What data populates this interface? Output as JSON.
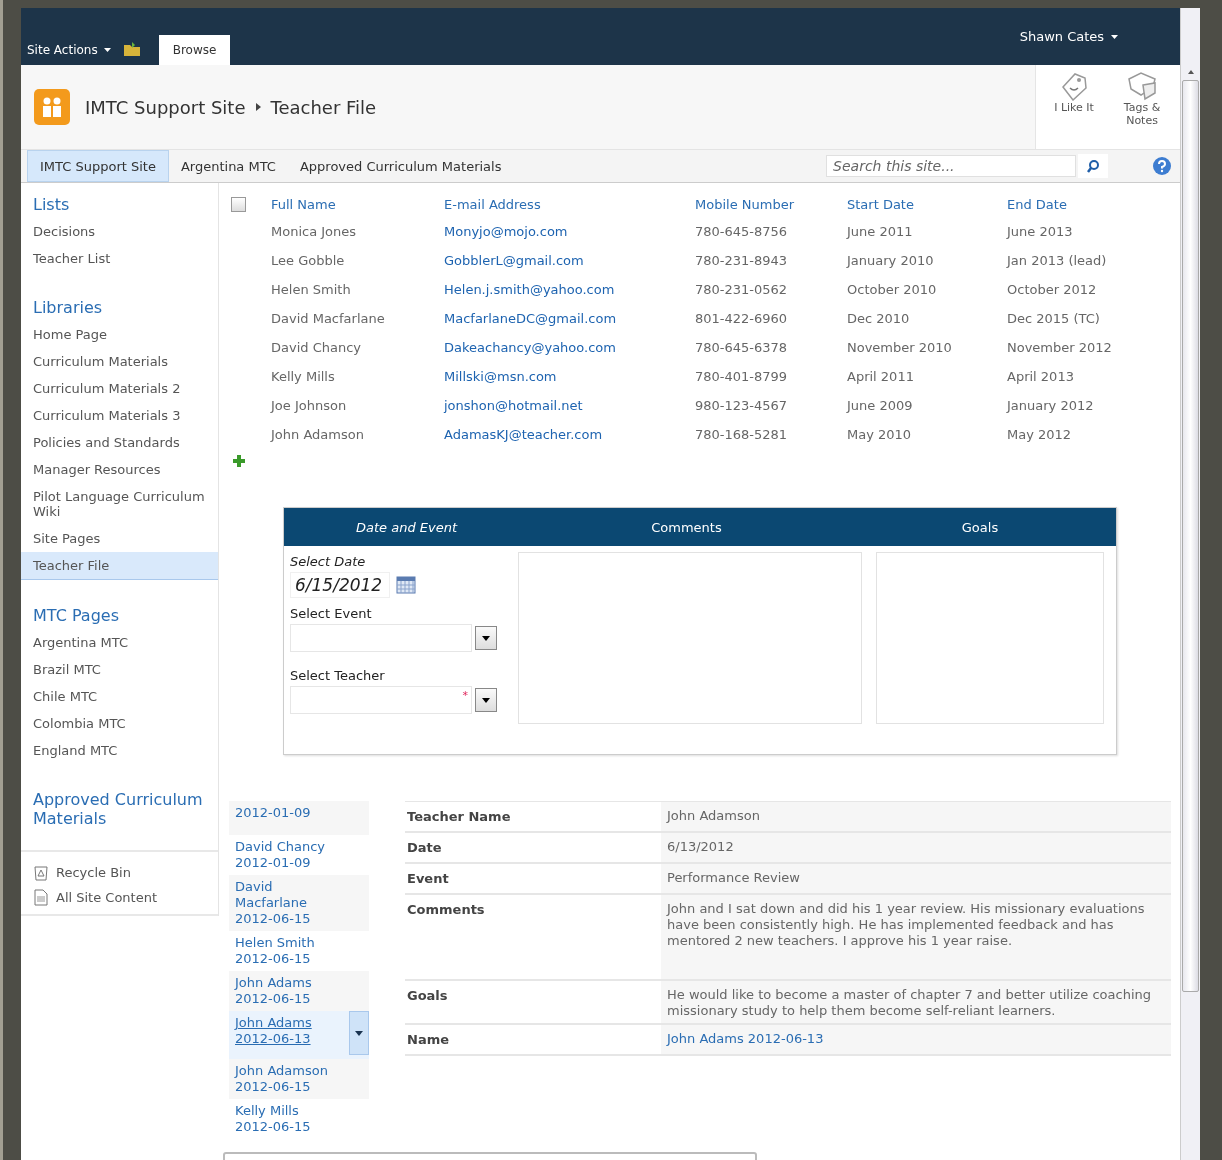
{
  "top_bar": {
    "site_actions": "Site Actions",
    "tabs": [
      {
        "label": "Browse",
        "selected": true
      }
    ],
    "user": "Shawn Cates"
  },
  "header": {
    "breadcrumb": [
      "IMTC Support Site",
      "Teacher File"
    ],
    "actions": [
      {
        "label": "I Like It",
        "kind": "like"
      },
      {
        "label": "Tags & Notes",
        "kind": "tags"
      }
    ]
  },
  "nav_tabs": [
    {
      "label": "IMTC Support Site",
      "selected": true
    },
    {
      "label": "Argentina MTC",
      "selected": false
    },
    {
      "label": "Approved Curriculum Materials",
      "selected": false
    }
  ],
  "search": {
    "placeholder": "Search this site..."
  },
  "quick_launch": {
    "sections": [
      {
        "heading": "Lists",
        "items": [
          {
            "label": "Decisions",
            "selected": false
          },
          {
            "label": "Teacher List",
            "selected": false
          }
        ]
      },
      {
        "heading": "Libraries",
        "items": [
          {
            "label": "Home Page",
            "selected": false
          },
          {
            "label": "Curriculum Materials",
            "selected": false
          },
          {
            "label": "Curriculum Materials 2",
            "selected": false
          },
          {
            "label": "Curriculum Materials 3",
            "selected": false
          },
          {
            "label": "Policies and Standards",
            "selected": false
          },
          {
            "label": "Manager Resources",
            "selected": false
          },
          {
            "label": "Pilot Language Curriculum Wiki",
            "selected": false
          },
          {
            "label": "Site Pages",
            "selected": false
          },
          {
            "label": "Teacher File",
            "selected": true
          }
        ]
      },
      {
        "heading": "MTC Pages",
        "items": [
          {
            "label": "Argentina MTC",
            "selected": false
          },
          {
            "label": "Brazil MTC",
            "selected": false
          },
          {
            "label": "Chile MTC",
            "selected": false
          },
          {
            "label": "Colombia MTC",
            "selected": false
          },
          {
            "label": "England MTC",
            "selected": false
          }
        ]
      },
      {
        "heading": "Approved Curriculum Materials"
      }
    ],
    "footer": [
      {
        "label": "Recycle Bin",
        "kind": "recycle"
      },
      {
        "label": "All Site Content",
        "kind": "content"
      }
    ]
  },
  "teacher_table": {
    "select_all": {
      "checked": false
    },
    "columns": [
      "Full Name",
      "E-mail Address",
      "Mobile Number",
      "Start Date",
      "End Date"
    ],
    "rows": [
      [
        "Monica Jones",
        "Monyjo@mojo.com",
        "780-645-8756",
        "June 2011",
        "June 2013"
      ],
      [
        "Lee Gobble",
        "GobblerL@gmail.com",
        "780-231-8943",
        "January 2010",
        "Jan 2013 (lead)"
      ],
      [
        "Helen Smith",
        "Helen.j.smith@yahoo.com",
        "780-231-0562",
        "October 2010",
        "October 2012"
      ],
      [
        "David Macfarlane",
        "MacfarlaneDC@gmail.com",
        "801-422-6960",
        "Dec 2010",
        "Dec 2015 (TC)"
      ],
      [
        "David Chancy",
        "Dakeachancy@yahoo.com",
        "780-645-6378",
        "November 2010",
        "November 2012"
      ],
      [
        "Kelly Mills",
        "Millski@msn.com",
        "780-401-8799",
        "April 2011",
        "April 2013"
      ],
      [
        "Joe Johnson",
        "jonshon@hotmail.net",
        "980-123-4567",
        "June 2009",
        "January 2012"
      ],
      [
        "John Adamson",
        "AdamasKJ@teacher.com",
        "780-168-5281",
        "May 2010",
        "May 2012"
      ]
    ]
  },
  "form": {
    "headers": [
      {
        "label": "Date and Event",
        "italic": true
      },
      {
        "label": "Comments",
        "italic": false
      },
      {
        "label": "Goals",
        "italic": false
      }
    ],
    "date": {
      "label": "Select Date",
      "value": "6/15/2012"
    },
    "event": {
      "label": "Select Event"
    },
    "teacher": {
      "label": "Select Teacher",
      "required": true,
      "marker": "*"
    }
  },
  "entries": [
    {
      "date": "2012-01-09",
      "selected": false
    },
    {
      "name": "David Chancy",
      "date": "2012-01-09",
      "selected": false
    },
    {
      "name": "David Macfarlane",
      "date": "2012-06-15",
      "selected": false
    },
    {
      "name": "Helen Smith",
      "date": "2012-06-15",
      "selected": false
    },
    {
      "name": "John Adams",
      "date": "2012-06-15",
      "selected": false
    },
    {
      "name": "John Adams",
      "date": "2012-06-13",
      "selected": true
    },
    {
      "name": "John Adamson",
      "date": "2012-06-15",
      "selected": false
    },
    {
      "name": "Kelly Mills",
      "date": "2012-06-15",
      "selected": false
    }
  ],
  "details": [
    {
      "label": "Teacher Name",
      "value": "John Adamson",
      "kind": "text"
    },
    {
      "label": "Date",
      "value": "6/13/2012",
      "kind": "text"
    },
    {
      "label": "Event",
      "value": "Performance Review",
      "kind": "text"
    },
    {
      "label": "Comments",
      "value": "John and I sat down and did his 1 year review. His missionary evaluations have been consistently high. He has implemented feedback and has mentored 2 new teachers. I approve his 1 year raise.",
      "kind": "long"
    },
    {
      "label": "Goals",
      "value": "He would like to become a master of chapter 7 and better utilize coaching missionary study to help them become self-reliant learners.",
      "kind": "text"
    },
    {
      "label": "Name",
      "value": "John Adams 2012-06-13",
      "kind": "link"
    }
  ]
}
